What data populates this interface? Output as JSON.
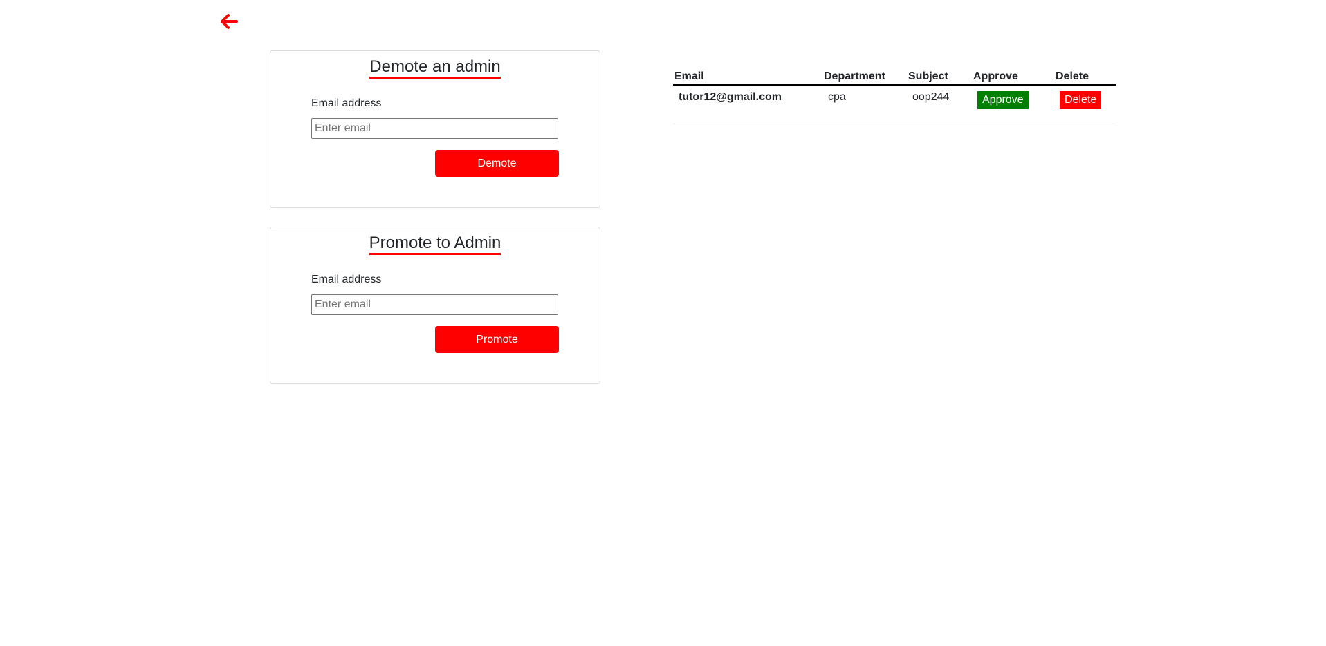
{
  "back": {
    "icon": "arrow-left-icon",
    "color": "#ff0000"
  },
  "demote": {
    "title": "Demote an admin",
    "label": "Email address",
    "placeholder": "Enter email",
    "value": "",
    "button": "Demote"
  },
  "promote": {
    "title": "Promote to Admin",
    "label": "Email address",
    "placeholder": "Enter email",
    "value": "",
    "button": "Promote"
  },
  "table": {
    "headers": [
      "Email",
      "Department",
      "Subject",
      "Approve",
      "Delete"
    ],
    "rows": [
      {
        "email": "tutor12@gmail.com",
        "department": "cpa",
        "subject": "oop244",
        "approve_label": "Approve",
        "delete_label": "Delete"
      }
    ]
  },
  "colors": {
    "accent": "#ff0000",
    "approve": "#008000"
  }
}
